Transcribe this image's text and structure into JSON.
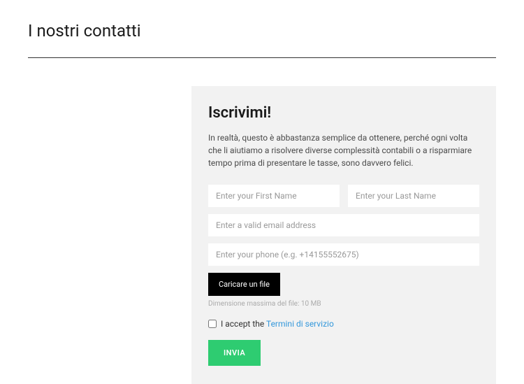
{
  "page": {
    "title": "I nostri contatti"
  },
  "form": {
    "title": "Iscrivimi!",
    "description": "In realtà, questo è abbastanza semplice da ottenere, perché ogni volta che li aiutiamo a risolvere diverse complessità contabili o a risparmiare tempo prima di presentare le tasse, sono davvero felici.",
    "firstName": {
      "placeholder": "Enter your First Name",
      "value": ""
    },
    "lastName": {
      "placeholder": "Enter your Last Name",
      "value": ""
    },
    "email": {
      "placeholder": "Enter a valid email address",
      "value": ""
    },
    "phone": {
      "placeholder": "Enter your phone (e.g. +14155552675)",
      "value": ""
    },
    "fileButton": "Caricare un file",
    "fileHint": "Dimensione massima del file: 10 MB",
    "acceptText": "I accept the ",
    "termsLink": "Termini di servizio",
    "submitLabel": "INVIA"
  },
  "colors": {
    "panelBg": "#f2f2f2",
    "submitBg": "#2ecc71",
    "fileBg": "#000000",
    "link": "#3498db"
  }
}
